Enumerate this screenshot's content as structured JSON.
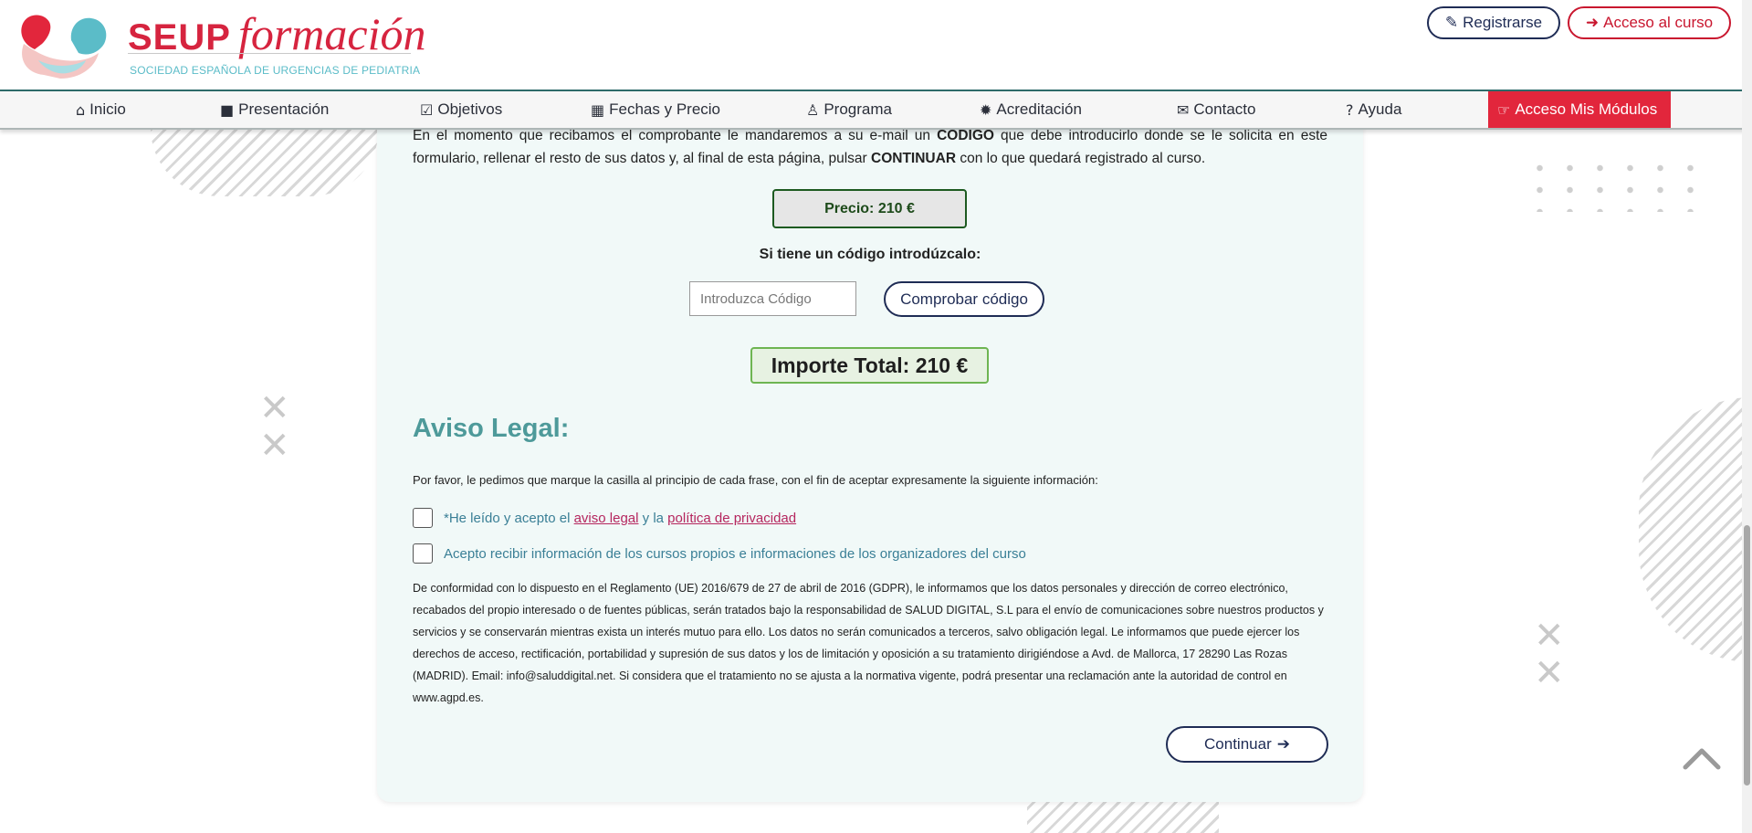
{
  "header": {
    "logo_title": "SEUP",
    "logo_script": "formación",
    "logo_subtitle": "SOCIEDAD ESPAÑOLA DE URGENCIAS DE PEDIATRIA",
    "register_label": "Registrarse",
    "course_access_label": "Acceso al curso"
  },
  "nav": {
    "items": [
      {
        "label": "Inicio",
        "icon": "home-icon"
      },
      {
        "label": "Presentación",
        "icon": "video-icon"
      },
      {
        "label": "Objetivos",
        "icon": "check-square-icon"
      },
      {
        "label": "Fechas y Precio",
        "icon": "calendar-icon"
      },
      {
        "label": "Programa",
        "icon": "user-icon"
      },
      {
        "label": "Acreditación",
        "icon": "certificate-icon"
      },
      {
        "label": "Contacto",
        "icon": "envelope-icon"
      },
      {
        "label": "Ayuda",
        "icon": "question-circle-icon"
      },
      {
        "label": "Acceso Mis Módulos",
        "icon": "pointer-icon",
        "active": true
      }
    ]
  },
  "form": {
    "intro_1": "En el momento que recibamos el comprobante le mandaremos a su e-mail un ",
    "intro_bold_1": "CODIGO",
    "intro_2": " que debe introducirlo donde se le solicita en este formulario, rellenar el resto de sus datos y, al final de esta página, pulsar ",
    "intro_bold_2": "CONTINUAR",
    "intro_3": " con lo que quedará registrado al curso.",
    "price": "Precio: 210 €",
    "code_label": "Si tiene un código introdúzcalo:",
    "code_placeholder": "Introduzca Código",
    "code_value": "",
    "check_code_label": "Comprobar código",
    "total": "Importe Total: 210 €"
  },
  "legal": {
    "title": "Aviso Legal:",
    "intro": "Por favor, le pedimos que marque la casilla al principio de cada frase, con el fin de aceptar expresamente la siguiente información:",
    "check1_prefix": "*He leído y acepto el ",
    "check1_link1": "aviso legal",
    "check1_mid": " y la ",
    "check1_link2": "política de privacidad",
    "check1_checked": false,
    "check2_text": "Acepto recibir información de los cursos propios e informaciones de los organizadores del curso",
    "check2_checked": false,
    "gdpr_text": "De conformidad con lo dispuesto en el Reglamento (UE) 2016/679 de 27 de abril de 2016 (GDPR), le informamos que los datos personales y dirección de correo electrónico, recabados del propio interesado o de fuentes públicas, serán tratados bajo la responsabilidad de SALUD DIGITAL, S.L para el envío de comunicaciones sobre nuestros productos y servicios y se conservarán mientras exista un interés mutuo para ello. Los datos no serán comunicados a terceros, salvo obligación legal. Le informamos que puede ejercer los derechos de acceso, rectificación, portabilidad y supresión de sus datos y los de limitación y oposición a su tratamiento dirigiéndose a Avd. de Mallorca, 17 28290 Las Rozas (MADRID). Email: info@saluddigital.net. Si considera que el tratamiento no se ajusta a la normativa vigente, podrá presentar una reclamación ante la autoridad de control en www.agpd.es.",
    "continue_label": "Continuar"
  },
  "colors": {
    "brand_red": "#d6243f",
    "brand_teal": "#5bbcc8",
    "navy": "#1f2c55",
    "title_teal": "#4e9a9a"
  }
}
